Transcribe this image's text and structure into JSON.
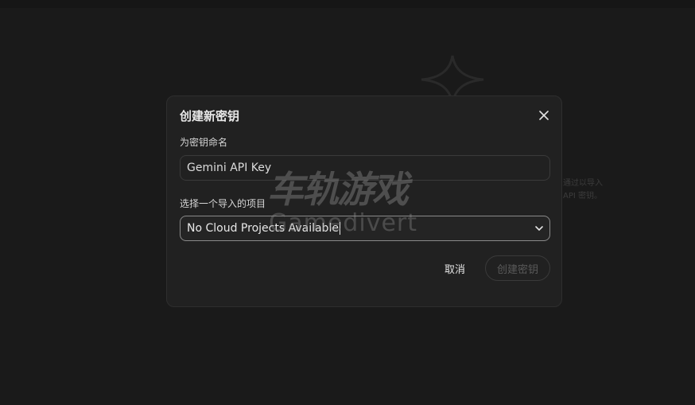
{
  "background": {
    "partial_text_line1": "通过以导入",
    "partial_text_line2": "API 密钥。"
  },
  "dialog": {
    "title": "创建新密钥",
    "close_icon": "close-icon",
    "name_field": {
      "label": "为密钥命名",
      "value": "Gemini API Key"
    },
    "project_field": {
      "label": "选择一个导入的项目",
      "value": "No Cloud Projects Available",
      "icon": "chevron-down-icon"
    },
    "cancel_label": "取消",
    "create_label": "创建密钥"
  },
  "watermark": {
    "text_cn": "车轨游戏",
    "text_en": "Gamedivert"
  },
  "colors": {
    "page_bg": "#1a1a1a",
    "dialog_bg": "#212121",
    "text_primary": "#e3e3e3",
    "disabled_text": "#5a5a5a"
  }
}
